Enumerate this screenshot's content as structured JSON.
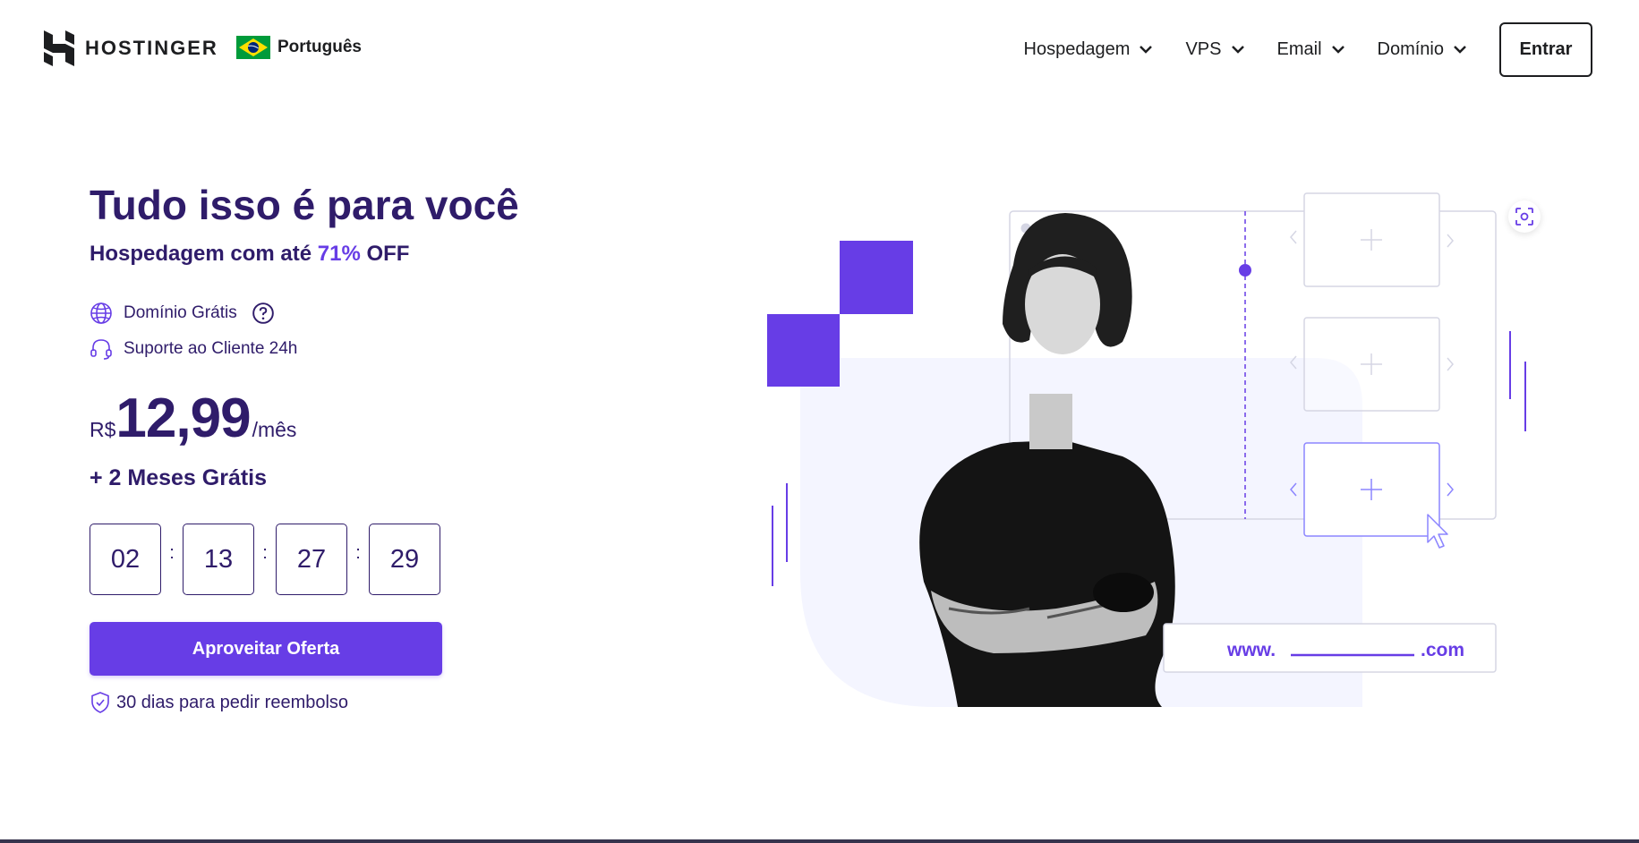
{
  "brand": {
    "name": "HOSTINGER"
  },
  "language": {
    "label": "Português",
    "flag": "brazil-flag-icon"
  },
  "nav": {
    "items": [
      {
        "label": "Hospedagem"
      },
      {
        "label": "VPS"
      },
      {
        "label": "Email"
      },
      {
        "label": "Domínio"
      }
    ],
    "login_label": "Entrar"
  },
  "hero": {
    "title": "Tudo isso é para você",
    "subtitle_prefix": "Hospedagem com até ",
    "subtitle_accent": "71%",
    "subtitle_suffix": " OFF",
    "features": [
      {
        "label": "Domínio Grátis",
        "icon": "globe-icon"
      },
      {
        "label": "Suporte ao Cliente 24h",
        "icon": "headset-icon"
      }
    ],
    "price": {
      "currency": "R$",
      "amount": "12,99",
      "period": "/mês"
    },
    "bonus": "+ 2 Meses Grátis",
    "countdown": {
      "days": "02",
      "hours": "13",
      "minutes": "27",
      "seconds": "29",
      "separator": ":"
    },
    "cta_label": "Aproveitar Oferta",
    "refund_text": "30 dias para pedir reembolso"
  },
  "illustration": {
    "domain_prefix": "www.",
    "domain_suffix": ".com"
  },
  "colors": {
    "accent": "#673de6",
    "heading": "#2f1c6a",
    "text": "#1d1e20",
    "light_bg": "#f4f5ff"
  }
}
